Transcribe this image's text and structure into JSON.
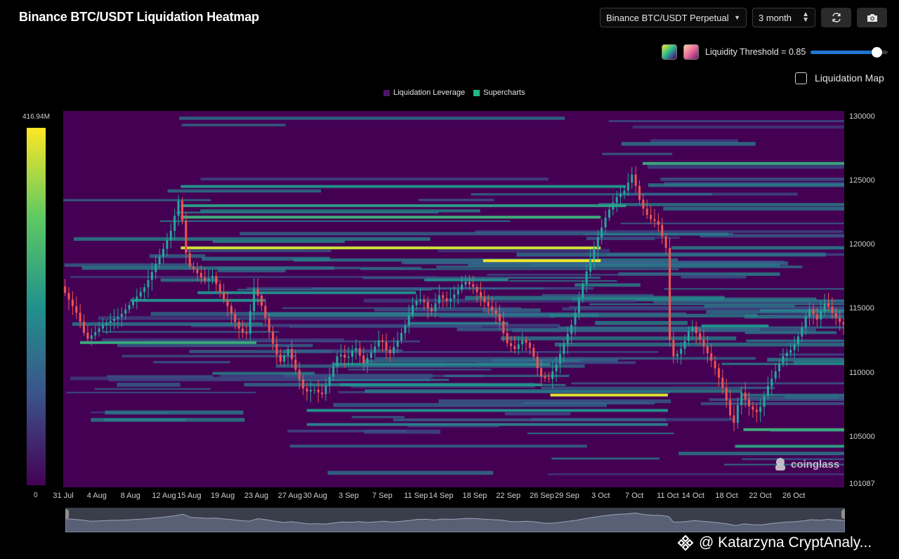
{
  "header": {
    "title": "Binance BTC/USDT Liquidation Heatmap",
    "pair_select": "Binance BTC/USDT Perpetual",
    "range_select": "3 month"
  },
  "controls": {
    "threshold_label": "Liquidity Threshold = 0.85",
    "threshold_value": 0.85,
    "liquidation_map_label": "Liquidation Map",
    "liquidation_map_checked": false,
    "swatch_colors": [
      "#2fc08e",
      "#e86a9a"
    ]
  },
  "legend": {
    "items": [
      {
        "label": "Liquidation Leverage",
        "color": "#4b1569"
      },
      {
        "label": "Supercharts",
        "color": "#22b889"
      }
    ]
  },
  "scale": {
    "max_label": "416.94M",
    "min_label": "0"
  },
  "watermark": "coinglass",
  "credit": "@ Katarzyna CryptAnaly...",
  "colors": {
    "heat_low": "#440154",
    "heat_mid": "#21918c",
    "heat_high": "#fde725",
    "candle_up": "#26a69a",
    "candle_down": "#ef5350"
  },
  "chart_data": {
    "type": "heatmap",
    "title": "Binance BTC/USDT Liquidation Heatmap",
    "x_tick_labels": [
      "31 Jul",
      "4 Aug",
      "8 Aug",
      "12 Aug",
      "15 Aug",
      "19 Aug",
      "23 Aug",
      "27 Aug",
      "30 Aug",
      "3 Sep",
      "7 Sep",
      "11 Sep",
      "14 Sep",
      "18 Sep",
      "22 Sep",
      "26 Sep",
      "29 Sep",
      "3 Oct",
      "7 Oct",
      "11 Oct",
      "14 Oct",
      "18 Oct",
      "22 Oct",
      "26 Oct"
    ],
    "y_tick_labels": [
      "130000",
      "125000",
      "120000",
      "115000",
      "110000",
      "105000",
      "101087"
    ],
    "y_ticks": [
      130000,
      125000,
      120000,
      115000,
      110000,
      105000
    ],
    "ylim": [
      101087,
      130500
    ],
    "x_domain": [
      0,
      93
    ],
    "x_tick_positions": [
      0,
      4,
      8,
      12,
      15,
      19,
      23,
      27,
      30,
      34,
      38,
      42,
      45,
      49,
      53,
      57,
      60,
      64,
      68,
      72,
      75,
      79,
      83,
      87
    ],
    "color_scale_range": [
      0,
      416.94
    ],
    "price_path": [
      [
        0,
        116800
      ],
      [
        2,
        114500
      ],
      [
        3,
        112600
      ],
      [
        5,
        113800
      ],
      [
        7,
        114500
      ],
      [
        9,
        116000
      ],
      [
        10,
        116800
      ],
      [
        11,
        118200
      ],
      [
        12,
        119500
      ],
      [
        13,
        121000
      ],
      [
        14,
        123600
      ],
      [
        14.5,
        121500
      ],
      [
        15,
        118500
      ],
      [
        16,
        118000
      ],
      [
        17,
        117200
      ],
      [
        18,
        117600
      ],
      [
        19,
        116200
      ],
      [
        20,
        115000
      ],
      [
        21,
        113600
      ],
      [
        22,
        112900
      ],
      [
        23,
        116800
      ],
      [
        24,
        115000
      ],
      [
        25,
        112700
      ],
      [
        26,
        110800
      ],
      [
        27,
        111900
      ],
      [
        28,
        110100
      ],
      [
        29,
        108500
      ],
      [
        30,
        108800
      ],
      [
        31,
        108300
      ],
      [
        32,
        109800
      ],
      [
        33,
        111600
      ],
      [
        34,
        111100
      ],
      [
        35,
        112100
      ],
      [
        36,
        110800
      ],
      [
        37,
        111700
      ],
      [
        38,
        112800
      ],
      [
        39,
        111400
      ],
      [
        40,
        112500
      ],
      [
        41,
        113800
      ],
      [
        42,
        115600
      ],
      [
        43,
        115800
      ],
      [
        44,
        114700
      ],
      [
        45,
        116100
      ],
      [
        46,
        115600
      ],
      [
        47,
        116300
      ],
      [
        48,
        117200
      ],
      [
        49,
        116800
      ],
      [
        50,
        115900
      ],
      [
        51,
        115100
      ],
      [
        52,
        114500
      ],
      [
        53,
        112400
      ],
      [
        54,
        111900
      ],
      [
        55,
        112700
      ],
      [
        56,
        111800
      ],
      [
        57,
        109800
      ],
      [
        58,
        109500
      ],
      [
        59,
        110800
      ],
      [
        60,
        112600
      ],
      [
        61,
        114200
      ],
      [
        62,
        116800
      ],
      [
        63,
        118900
      ],
      [
        64,
        120800
      ],
      [
        65,
        122500
      ],
      [
        66,
        123700
      ],
      [
        67,
        124200
      ],
      [
        68,
        125600
      ],
      [
        69,
        123200
      ],
      [
        70,
        122100
      ],
      [
        71,
        121800
      ],
      [
        72,
        119800
      ],
      [
        72.5,
        111800
      ],
      [
        73,
        111200
      ],
      [
        74,
        112100
      ],
      [
        75,
        113800
      ],
      [
        76,
        112700
      ],
      [
        77,
        111500
      ],
      [
        78,
        110200
      ],
      [
        79,
        108400
      ],
      [
        80,
        105800
      ],
      [
        80.5,
        107400
      ],
      [
        81,
        108500
      ],
      [
        82,
        107300
      ],
      [
        83,
        106900
      ],
      [
        84,
        108800
      ],
      [
        85,
        110100
      ],
      [
        86,
        111400
      ],
      [
        87,
        111900
      ],
      [
        88,
        113200
      ],
      [
        89,
        115100
      ],
      [
        90,
        114200
      ],
      [
        91,
        115600
      ],
      [
        92,
        114500
      ],
      [
        93,
        113800
      ]
    ],
    "liquidation_bands": [
      {
        "price": 119800,
        "x_start": 14,
        "x_end": 64,
        "intensity": 0.92
      },
      {
        "price": 118800,
        "x_start": 50,
        "x_end": 64,
        "intensity": 0.98
      },
      {
        "price": 108300,
        "x_start": 58,
        "x_end": 72,
        "intensity": 0.95
      },
      {
        "price": 122200,
        "x_start": 14,
        "x_end": 64,
        "intensity": 0.62
      },
      {
        "price": 123100,
        "x_start": 14,
        "x_end": 67,
        "intensity": 0.55
      },
      {
        "price": 124600,
        "x_start": 14,
        "x_end": 67,
        "intensity": 0.5
      },
      {
        "price": 126400,
        "x_start": 69,
        "x_end": 93,
        "intensity": 0.6
      },
      {
        "price": 112400,
        "x_start": 2,
        "x_end": 23,
        "intensity": 0.6
      },
      {
        "price": 116300,
        "x_start": 16,
        "x_end": 42,
        "intensity": 0.48
      },
      {
        "price": 115700,
        "x_start": 8,
        "x_end": 24,
        "intensity": 0.5
      },
      {
        "price": 110700,
        "x_start": 32,
        "x_end": 58,
        "intensity": 0.45
      },
      {
        "price": 109100,
        "x_start": 33,
        "x_end": 57,
        "intensity": 0.5
      },
      {
        "price": 107100,
        "x_start": 29,
        "x_end": 72,
        "intensity": 0.5
      },
      {
        "price": 106000,
        "x_start": 29,
        "x_end": 72,
        "intensity": 0.42
      },
      {
        "price": 105600,
        "x_start": 81,
        "x_end": 93,
        "intensity": 0.62
      },
      {
        "price": 104300,
        "x_start": 80,
        "x_end": 93,
        "intensity": 0.55
      },
      {
        "price": 113700,
        "x_start": 76,
        "x_end": 84,
        "intensity": 0.5
      },
      {
        "price": 114900,
        "x_start": 83,
        "x_end": 93,
        "intensity": 0.42
      },
      {
        "price": 117300,
        "x_start": 43,
        "x_end": 53,
        "intensity": 0.45
      },
      {
        "price": 113900,
        "x_start": 41,
        "x_end": 53,
        "intensity": 0.4
      }
    ]
  }
}
